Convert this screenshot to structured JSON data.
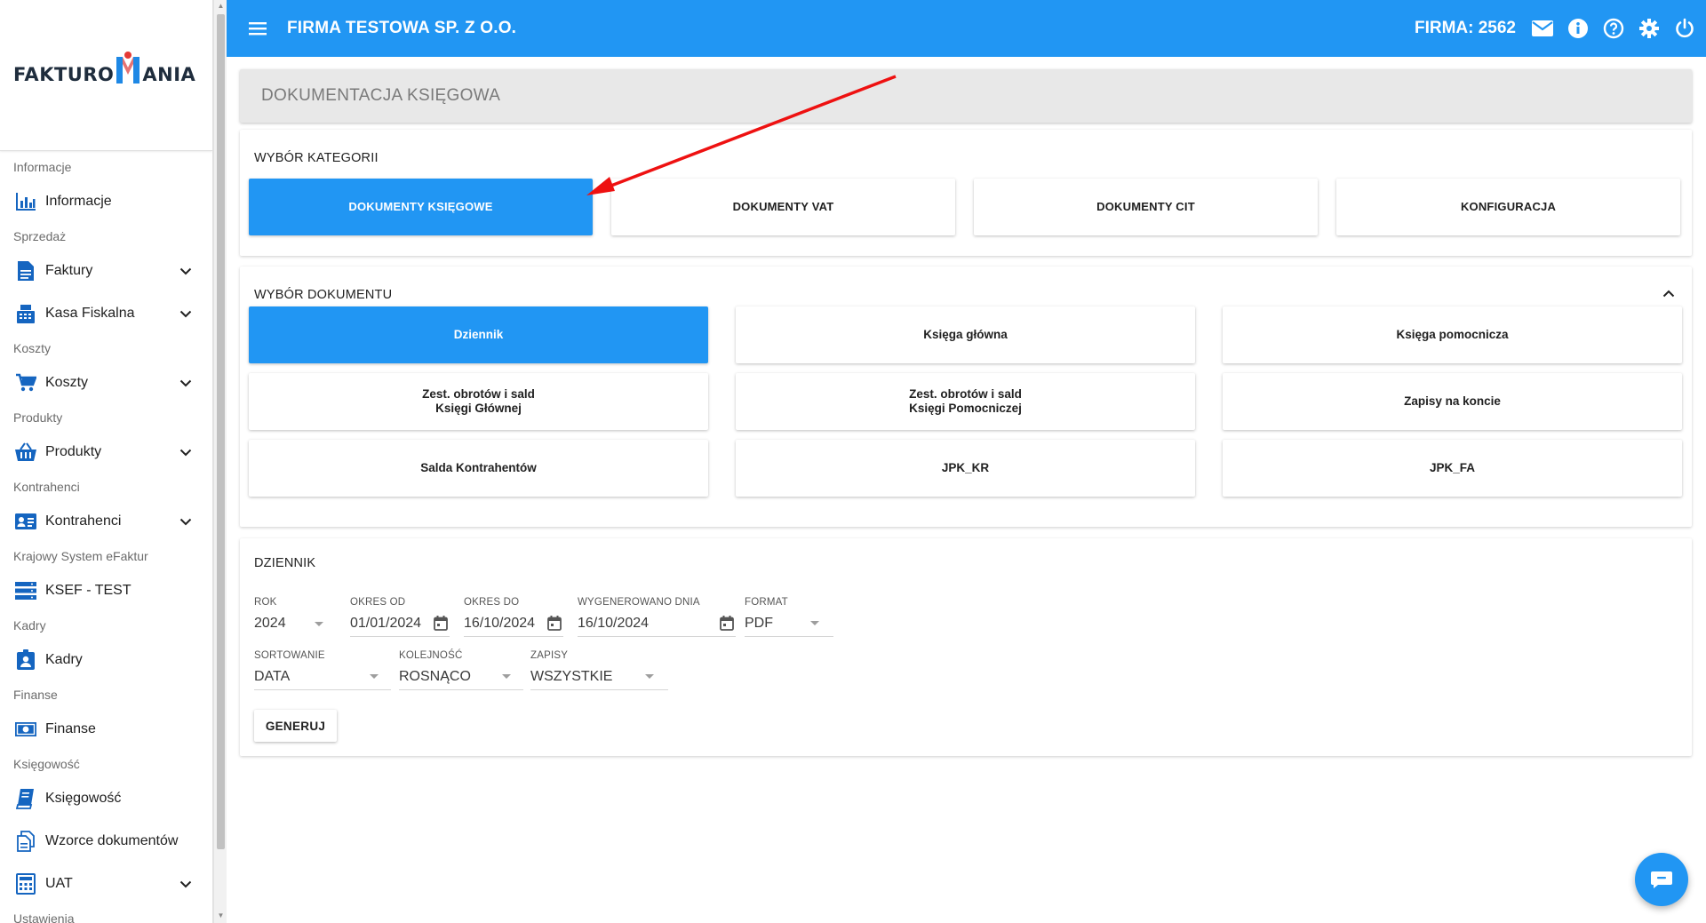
{
  "app": {
    "logo_left": "FAKTURO",
    "logo_right": "ANIA",
    "logo_m_colors": [
      "#1e88e5",
      "#e53935"
    ]
  },
  "sidebar": {
    "entries": [
      {
        "kind": "section",
        "label": "Informacje"
      },
      {
        "kind": "item",
        "label": "Informacje",
        "icon": "bar-chart-icon",
        "chevron": false
      },
      {
        "kind": "section",
        "label": "Sprzedaż"
      },
      {
        "kind": "item",
        "label": "Faktury",
        "icon": "document-icon",
        "chevron": true
      },
      {
        "kind": "item",
        "label": "Kasa Fiskalna",
        "icon": "cash-register-icon",
        "chevron": true
      },
      {
        "kind": "section",
        "label": "Koszty"
      },
      {
        "kind": "item",
        "label": "Koszty",
        "icon": "cart-icon",
        "chevron": true
      },
      {
        "kind": "section",
        "label": "Produkty"
      },
      {
        "kind": "item",
        "label": "Produkty",
        "icon": "basket-icon",
        "chevron": true
      },
      {
        "kind": "section",
        "label": "Kontrahenci"
      },
      {
        "kind": "item",
        "label": "Kontrahenci",
        "icon": "contact-card-icon",
        "chevron": true
      },
      {
        "kind": "section",
        "label": "Krajowy System eFaktur"
      },
      {
        "kind": "item",
        "label": "KSEF - TEST",
        "icon": "server-icon",
        "chevron": false
      },
      {
        "kind": "section",
        "label": "Kadry"
      },
      {
        "kind": "item",
        "label": "Kadry",
        "icon": "person-badge-icon",
        "chevron": false
      },
      {
        "kind": "section",
        "label": "Finanse"
      },
      {
        "kind": "item",
        "label": "Finanse",
        "icon": "money-icon",
        "chevron": false
      },
      {
        "kind": "section",
        "label": "Księgowość"
      },
      {
        "kind": "item",
        "label": "Księgowość",
        "icon": "book-icon",
        "chevron": false
      },
      {
        "kind": "item",
        "label": "Wzorce dokumentów",
        "icon": "copy-docs-icon",
        "chevron": false
      },
      {
        "kind": "item",
        "label": "UAT",
        "icon": "calculator-icon",
        "chevron": true
      },
      {
        "kind": "section",
        "label": "Ustawienia"
      }
    ]
  },
  "topbar": {
    "company_name": "FIRMA TESTOWA SP. Z O.O.",
    "firma_label": "FIRMA: 2562",
    "icons": [
      "mail-icon",
      "info-icon",
      "help-icon",
      "settings-icon",
      "power-icon"
    ]
  },
  "page": {
    "title": "DOKUMENTACJA KSIĘGOWA"
  },
  "categories": {
    "title": "WYBÓR KATEGORII",
    "items": [
      {
        "label": "DOKUMENTY KSIĘGOWE",
        "active": true
      },
      {
        "label": "DOKUMENTY VAT",
        "active": false
      },
      {
        "label": "DOKUMENTY CIT",
        "active": false
      },
      {
        "label": "KONFIGURACJA",
        "active": false
      }
    ]
  },
  "documents": {
    "title": "WYBÓR DOKUMENTU",
    "items": [
      {
        "line1": "Dziennik",
        "line2": "",
        "active": true
      },
      {
        "line1": "Księga główna",
        "line2": "",
        "active": false
      },
      {
        "line1": "Księga pomocnicza",
        "line2": "",
        "active": false
      },
      {
        "line1": "Zest. obrotów i sald",
        "line2": "Księgi Głównej",
        "active": false
      },
      {
        "line1": "Zest. obrotów i sald",
        "line2": "Księgi Pomocniczej",
        "active": false
      },
      {
        "line1": "Zapisy na koncie",
        "line2": "",
        "active": false
      },
      {
        "line1": "Salda Kontrahentów",
        "line2": "",
        "active": false
      },
      {
        "line1": "JPK_KR",
        "line2": "",
        "active": false
      },
      {
        "line1": "JPK_FA",
        "line2": "",
        "active": false
      }
    ]
  },
  "dziennik": {
    "title": "DZIENNIK",
    "rok": {
      "label": "ROK",
      "value": "2024"
    },
    "okres_od": {
      "label": "OKRES OD",
      "value": "01/01/2024"
    },
    "okres_do": {
      "label": "OKRES DO",
      "value": "16/10/2024"
    },
    "wygenerowano": {
      "label": "WYGENEROWANO DNIA",
      "value": "16/10/2024"
    },
    "format": {
      "label": "FORMAT",
      "value": "PDF"
    },
    "sortowanie": {
      "label": "SORTOWANIE",
      "value": "DATA"
    },
    "kolejnosc": {
      "label": "KOLEJNOŚĆ",
      "value": "ROSNĄCO"
    },
    "zapisy": {
      "label": "ZAPISY",
      "value": "WSZYSTKIE"
    },
    "generate_label": "GENERUJ"
  },
  "colors": {
    "primary": "#2196f3",
    "arrow": "#ee1111"
  }
}
